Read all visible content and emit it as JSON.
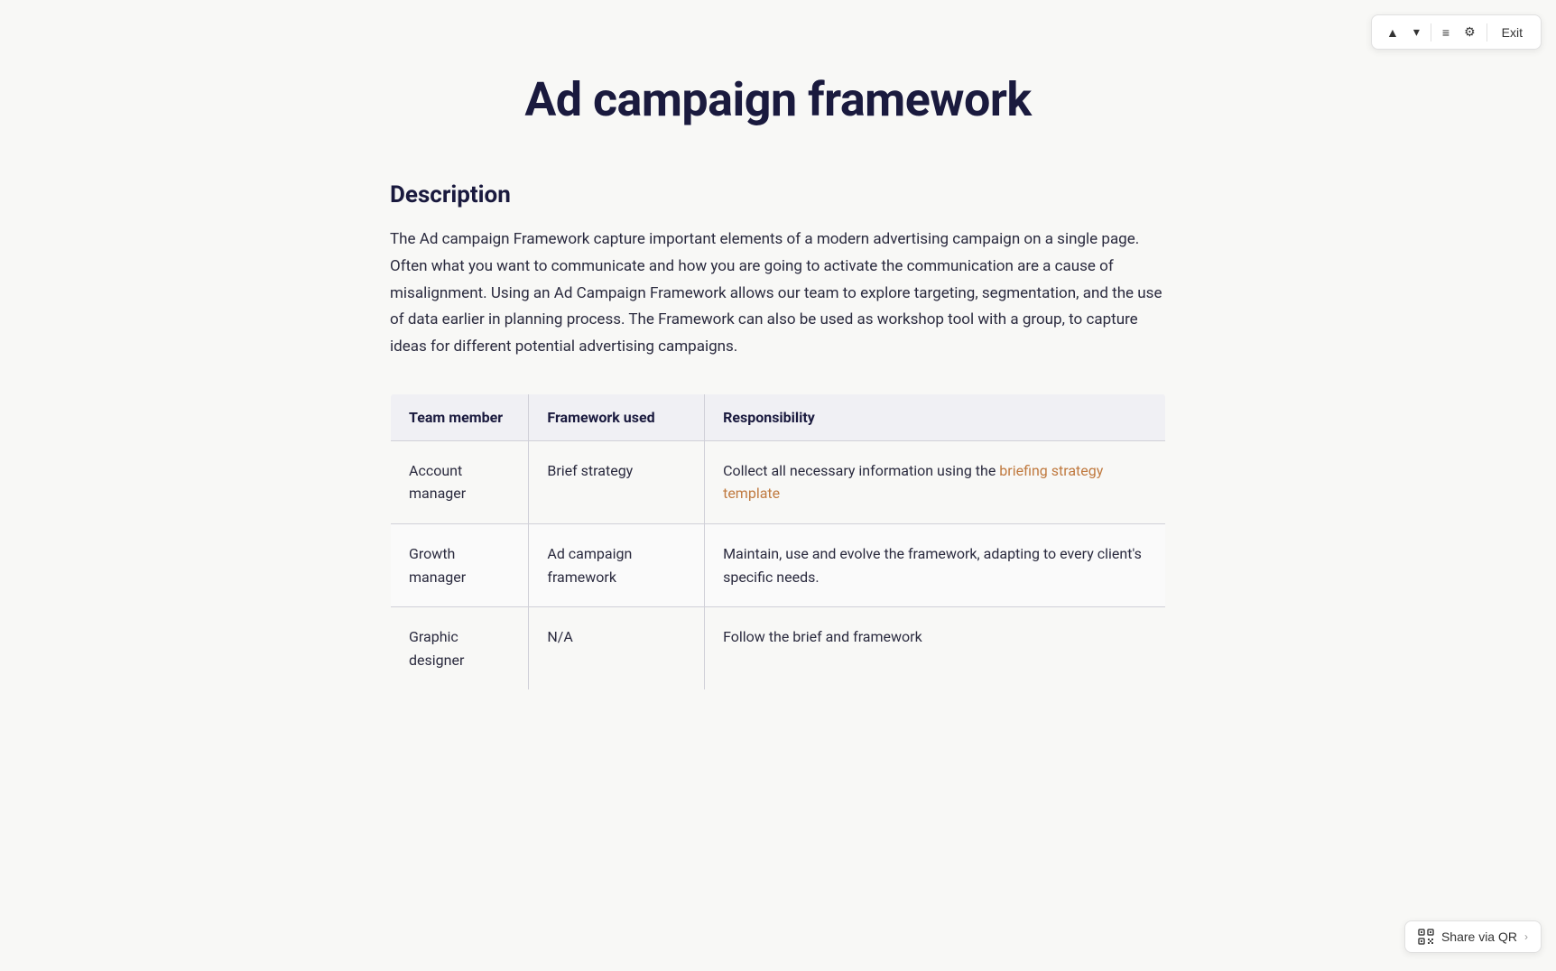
{
  "toolbar": {
    "up_arrow": "▲",
    "down_arrow": "▼",
    "list_icon": "≡",
    "settings_icon": "⚙",
    "exit_label": "Exit"
  },
  "page": {
    "title": "Ad campaign framework",
    "description_heading": "Description",
    "description_body": "The Ad campaign Framework capture important elements of a modern advertising campaign on a single page.  Often what you want to communicate and how you are going to activate the communication are a cause of misalignment.  Using an Ad Campaign Framework allows our team to explore targeting, segmentation, and the use of data earlier in planning process.  The Framework can also be used as workshop tool with a group, to capture ideas for different potential advertising campaigns."
  },
  "table": {
    "headers": [
      "Team member",
      "Framework used",
      "Responsibility"
    ],
    "rows": [
      {
        "team_member": "Account manager",
        "framework_used": "Brief strategy",
        "responsibility_before_link": "Collect all necessary information using the ",
        "link_text": "briefing strategy template",
        "responsibility_after_link": ""
      },
      {
        "team_member": "Growth manager",
        "framework_used": "Ad campaign framework",
        "responsibility": "Maintain, use and evolve the framework, adapting to every client's specific needs."
      },
      {
        "team_member": "Graphic designer",
        "framework_used": "N/A",
        "responsibility": "Follow the brief and framework"
      }
    ]
  },
  "share": {
    "label": "Share via QR"
  }
}
